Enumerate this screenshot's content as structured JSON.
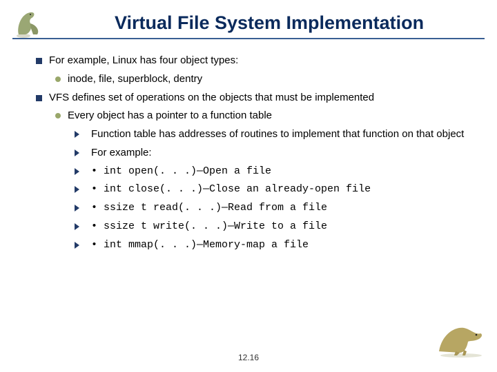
{
  "title": "Virtual File System Implementation",
  "b1": "For example, Linux has four object types:",
  "b1a": "inode, file, superblock, dentry",
  "b2": "VFS defines set of operations on the objects that must be implemented",
  "b2a": "Every object has a pointer to a function table",
  "b2a1": "Function table has addresses of routines to implement that function on that object",
  "b2a2": "For example:",
  "b2a3": "• int open(. . .)—Open a file",
  "b2a4": "• int close(. . .)—Close an already-open file",
  "b2a5": "• ssize t read(. . .)—Read from a file",
  "b2a6": "• ssize t write(. . .)—Write to a file",
  "b2a7": "• int mmap(. . .)—Memory-map a file",
  "page_num": "12.16"
}
